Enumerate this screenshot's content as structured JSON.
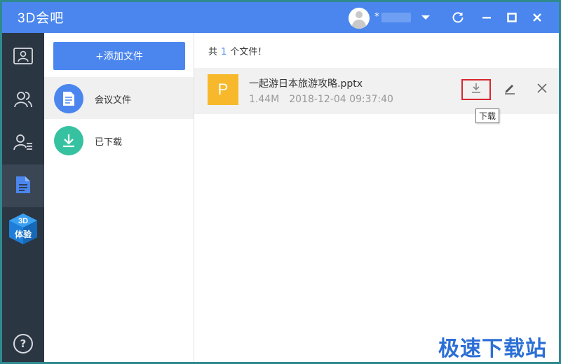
{
  "app": {
    "title": "3D会吧"
  },
  "user": {
    "name": "*"
  },
  "titlebar": {
    "icons": [
      "chevron-down-icon",
      "refresh-icon",
      "minimize-icon",
      "maximize-icon",
      "close-icon"
    ]
  },
  "sidebar": {
    "items": [
      {
        "icon": "conference-icon"
      },
      {
        "icon": "contacts-icon"
      },
      {
        "icon": "contact-list-icon"
      },
      {
        "icon": "document-icon",
        "active": true
      },
      {
        "icon": "3d-experience-icon",
        "text_top": "3D",
        "text_bottom": "体验"
      }
    ],
    "help_label": "?"
  },
  "categories": {
    "add_button_label": "+添加文件",
    "items": [
      {
        "label": "会议文件",
        "icon": "meeting-file-icon",
        "color": "#4a86ee",
        "active": true
      },
      {
        "label": "已下载",
        "icon": "download-icon",
        "color": "#36c2a0"
      }
    ]
  },
  "main": {
    "count_prefix": "共",
    "count": "1",
    "count_suffix": "个文件！",
    "files": [
      {
        "icon_letter": "P",
        "icon_color": "#f7b92b",
        "name": "一起游日本旅游攻略.pptx",
        "size": "1.44M",
        "date": "2018-12-04 09:37:40"
      }
    ],
    "tooltip": "下载"
  },
  "watermark": "极速下载站",
  "colors": {
    "accent": "#4a86ee",
    "sidebar": "#2b3643",
    "highlight": "#d9272e"
  }
}
